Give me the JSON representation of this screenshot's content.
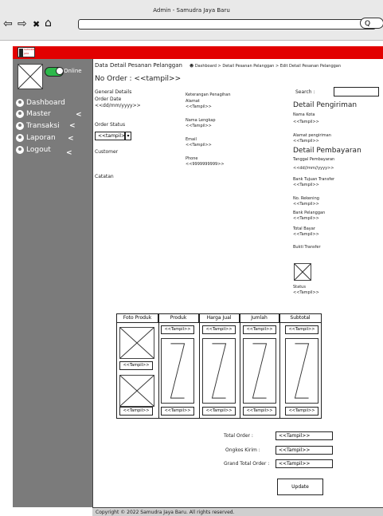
{
  "browser": {
    "title": "Admin - Samudra Jaya Baru",
    "nav_back": "⇦",
    "nav_forward": "⇨",
    "nav_close": "✖",
    "nav_home": "⌂",
    "search_glyph": "Q"
  },
  "brand": {
    "logo_text": "SAMUDRA JAYA BARU"
  },
  "sidebar": {
    "status_label": "Online",
    "items": [
      {
        "label": "Dashboard",
        "icon": "palette-icon",
        "has_chevron": false
      },
      {
        "label": "Master",
        "icon": "palette-icon",
        "has_chevron": true
      },
      {
        "label": "Transaksi",
        "icon": "palette-icon",
        "has_chevron": true
      },
      {
        "label": "Laporan",
        "icon": "palette-icon",
        "has_chevron": true
      },
      {
        "label": "Logout",
        "icon": "palette-icon",
        "has_chevron": true
      }
    ],
    "chevron": "<"
  },
  "header": {
    "page_title": "Data Detail Pesanan Pelanggan",
    "breadcrumb": [
      "Dashboard",
      ">",
      "Detail Pesanan Pelanggan",
      ">",
      "Edit Detail Pesanan Pelanggan"
    ]
  },
  "order": {
    "number_label": "No Order : <<tampil>>",
    "general_details": "General Details",
    "order_date_label": "Order Date",
    "order_date_value": "<<dd/mm/yyyy>>",
    "order_status_label": "Order Status",
    "order_status_value": "<<tampil>>",
    "customer_label": "Customer",
    "catatan_label": "Catatan"
  },
  "customer": {
    "keterangan": "Keterangan Penagihan",
    "alamat_label": "Alamat",
    "alamat_value": "<<Tampil>>",
    "nama_label": "Nama Lengkap",
    "nama_value": "<<Tampil>>",
    "email_label": "Email",
    "email_value": "<<Tampil>>",
    "phone_label": "Phone",
    "phone_value": "<<9999999999>>"
  },
  "search": {
    "label": "Search :"
  },
  "pengiriman": {
    "title": "Detail Pengiriman",
    "kota_label": "Nama Kota",
    "kota_value": "<<Tampil>>",
    "alamat_label": "Alamat pengiriman",
    "alamat_value": "<<Tampil>>"
  },
  "pembayaran": {
    "title": "Detail Pembayaran",
    "tanggal_label": "Tanggal Pembayaran",
    "tanggal_value": "<<dd//mm//yyyy>>",
    "bank_tujuan_label": "Bank Tujuan Transfer",
    "bank_tujuan_value": "<<Tampil>>",
    "rekening_label": "No. Rekening",
    "rekening_value": "<<Tampil>>",
    "bank_pelanggan_label": "Bank Pelanggan",
    "bank_pelanggan_value": "<<Tampil>>",
    "total_bayar_label": "Total Bayar",
    "total_bayar_value": "<<Tampil>>",
    "bukti_label": "Bukti Transfer",
    "status_label": "Status",
    "status_value": "<<Tampil>>"
  },
  "table": {
    "headers": [
      "Foto Produk",
      "Produk",
      "Harga Jual",
      "Jumlah",
      "Subtotal"
    ],
    "cell": "<<Tampil>>"
  },
  "totals": {
    "total_order_label": "Total Order :",
    "total_order_value": "<<Tampil>>",
    "ongkos_label": "Ongkos Kirim :",
    "ongkos_value": "<<Tampil>>",
    "grand_label": "Grand Total Order :",
    "grand_value": "<<Tampil>>"
  },
  "actions": {
    "update": "Update"
  },
  "footer": {
    "copyright": "Copyright © 2022 Samudra Jaya Baru. All rights reserved."
  }
}
